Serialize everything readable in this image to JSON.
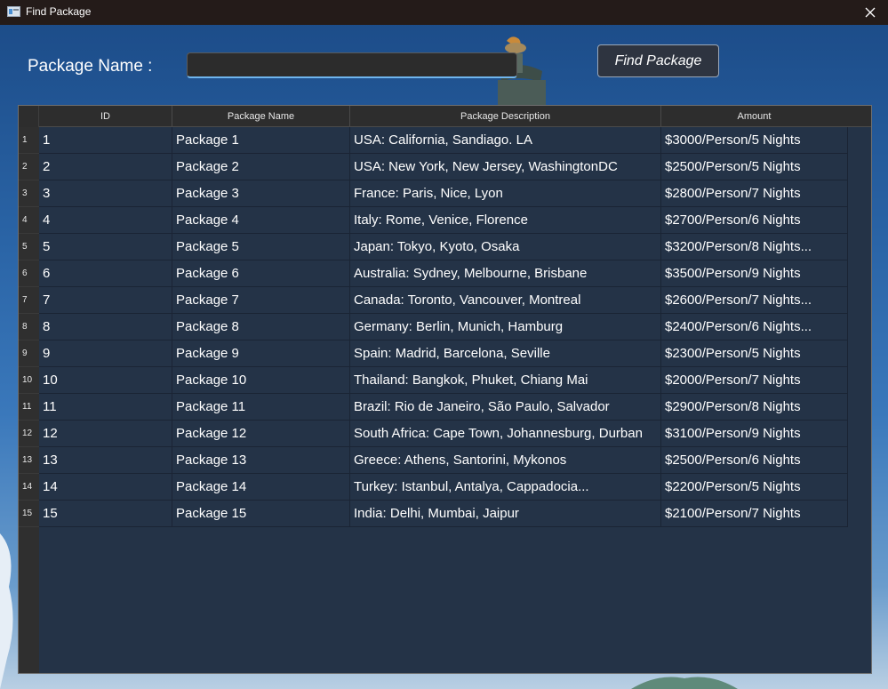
{
  "window": {
    "title": "Find Package",
    "close_icon": "close-icon",
    "app_icon": "window-app-icon"
  },
  "search": {
    "label": "Package Name :",
    "value": "",
    "placeholder": "",
    "button_label": "Find Package"
  },
  "table": {
    "columns": [
      "ID",
      "Package Name",
      "Package Description",
      "Amount"
    ],
    "rows": [
      {
        "num": "1",
        "id": "1",
        "name": "Package 1",
        "desc": "USA: California, Sandiago. LA",
        "amount": "$3000/Person/5 Nights"
      },
      {
        "num": "2",
        "id": "2",
        "name": "Package 2",
        "desc": "USA: New York, New Jersey, WashingtonDC",
        "amount": "$2500/Person/5 Nights"
      },
      {
        "num": "3",
        "id": "3",
        "name": "Package 3",
        "desc": "France: Paris, Nice, Lyon",
        "amount": "$2800/Person/7 Nights"
      },
      {
        "num": "4",
        "id": "4",
        "name": "Package 4",
        "desc": "Italy: Rome, Venice, Florence",
        "amount": "$2700/Person/6 Nights"
      },
      {
        "num": "5",
        "id": "5",
        "name": "Package 5",
        "desc": "Japan: Tokyo, Kyoto, Osaka",
        "amount": "$3200/Person/8 Nights..."
      },
      {
        "num": "6",
        "id": "6",
        "name": "Package 6",
        "desc": "Australia: Sydney, Melbourne, Brisbane",
        "amount": "$3500/Person/9 Nights"
      },
      {
        "num": "7",
        "id": "7",
        "name": "Package 7",
        "desc": "Canada: Toronto, Vancouver, Montreal",
        "amount": "$2600/Person/7 Nights..."
      },
      {
        "num": "8",
        "id": "8",
        "name": "Package 8",
        "desc": "Germany: Berlin, Munich, Hamburg",
        "amount": "$2400/Person/6 Nights..."
      },
      {
        "num": "9",
        "id": "9",
        "name": "Package 9",
        "desc": "Spain: Madrid, Barcelona, Seville",
        "amount": "$2300/Person/5 Nights"
      },
      {
        "num": "10",
        "id": "10",
        "name": "Package 10",
        "desc": "Thailand: Bangkok, Phuket, Chiang Mai",
        "amount": "$2000/Person/7 Nights"
      },
      {
        "num": "11",
        "id": "11",
        "name": "Package 11",
        "desc": "Brazil: Rio de Janeiro, São Paulo, Salvador",
        "amount": "$2900/Person/8 Nights"
      },
      {
        "num": "12",
        "id": "12",
        "name": "Package 12",
        "desc": "South Africa: Cape Town, Johannesburg, Durban",
        "amount": "$3100/Person/9 Nights"
      },
      {
        "num": "13",
        "id": "13",
        "name": "Package 13",
        "desc": "Greece: Athens, Santorini, Mykonos",
        "amount": "$2500/Person/6 Nights"
      },
      {
        "num": "14",
        "id": "14",
        "name": "Package 14",
        "desc": "Turkey: Istanbul, Antalya, Cappadocia...",
        "amount": "$2200/Person/5 Nights"
      },
      {
        "num": "15",
        "id": "15",
        "name": "Package 15",
        "desc": "India: Delhi, Mumbai, Jaipur",
        "amount": "$2100/Person/7 Nights"
      }
    ]
  },
  "colors": {
    "titlebar_bg": "#241b19",
    "table_bg": "#243347",
    "input_accent": "#6fb5ee"
  }
}
